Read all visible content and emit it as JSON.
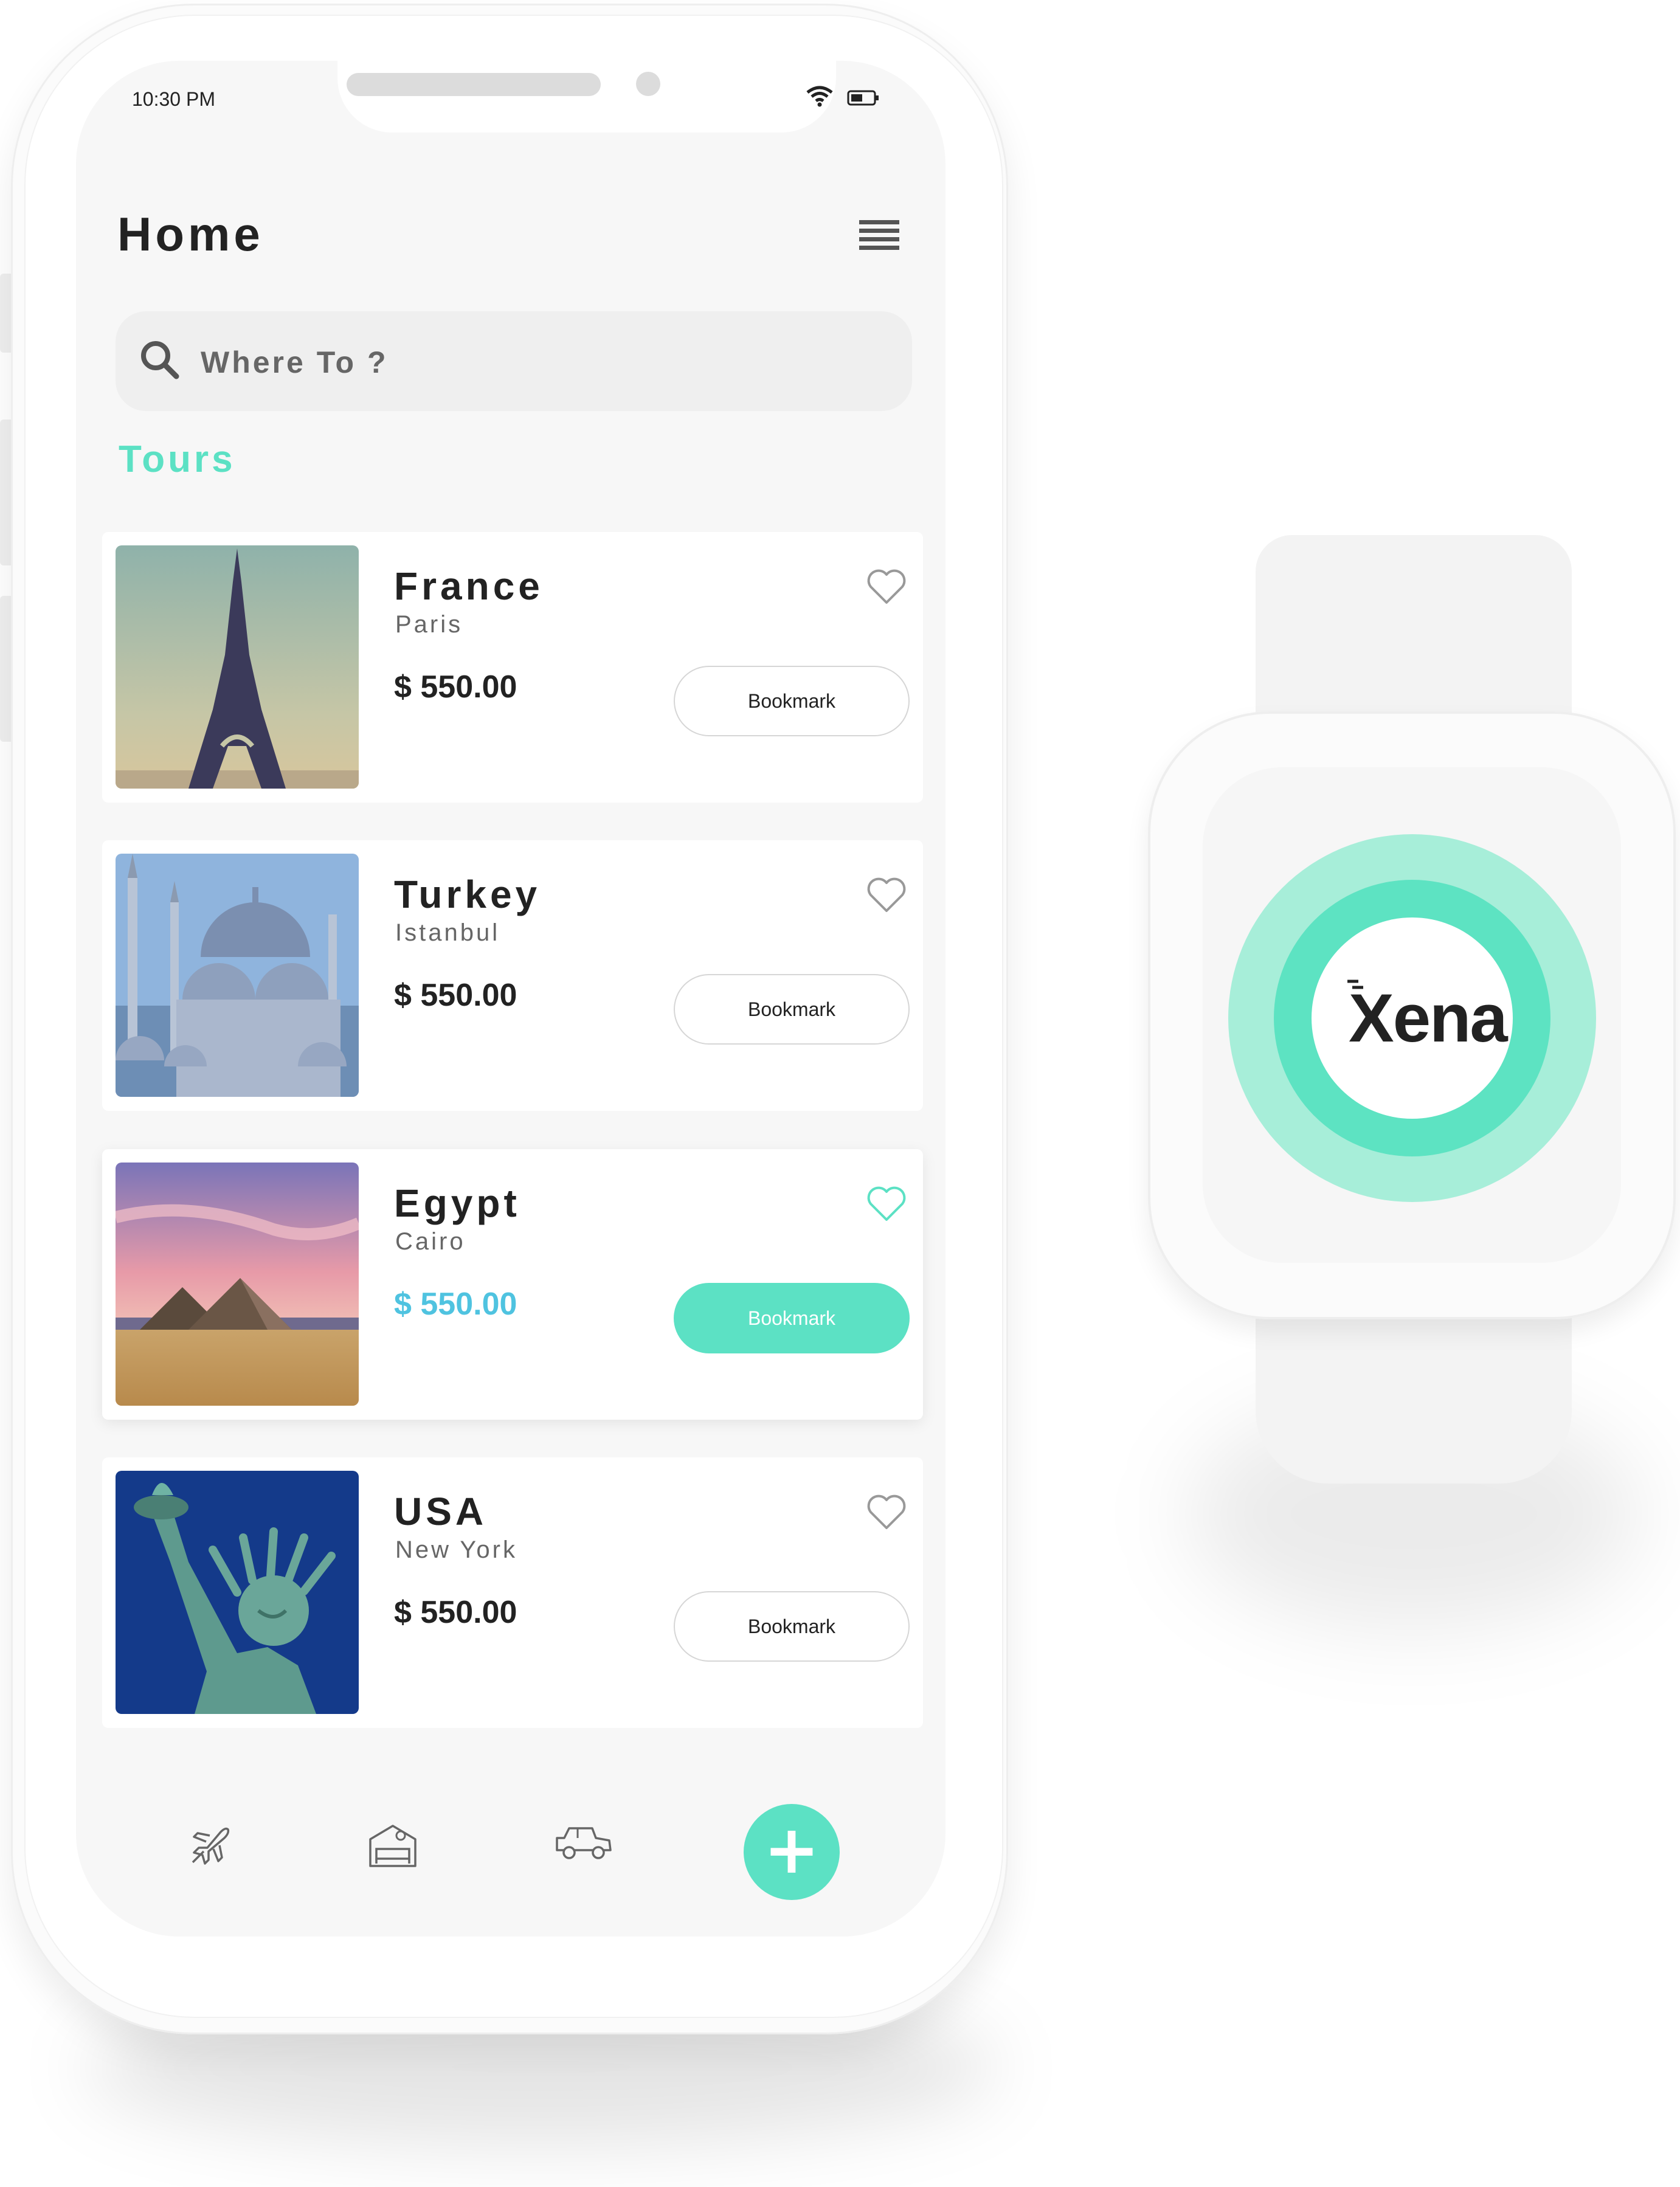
{
  "status_bar": {
    "time": "10:30 PM"
  },
  "header": {
    "title": "Home"
  },
  "search": {
    "placeholder": "Where To ?"
  },
  "section": {
    "title": "Tours"
  },
  "tours": [
    {
      "country": "France",
      "city": "Paris",
      "price": "$ 550.00",
      "button": "Bookmark",
      "favorited": false
    },
    {
      "country": "Turkey",
      "city": "Istanbul",
      "price": "$ 550.00",
      "button": "Bookmark",
      "favorited": false
    },
    {
      "country": "Egypt",
      "city": "Cairo",
      "price": "$ 550.00",
      "button": "Bookmark",
      "favorited": true
    },
    {
      "country": "USA",
      "city": "New York",
      "price": "$ 550.00",
      "button": "Bookmark",
      "favorited": false
    }
  ],
  "tab_bar": {
    "items": [
      "plane-icon",
      "hotel-bed-icon",
      "jeep-icon"
    ],
    "fab": "+"
  },
  "watch": {
    "logo_text": "Xena"
  },
  "colors": {
    "accent": "#5ce1c4",
    "price_highlight": "#4fc3e0",
    "ring_outer": "#a7eed9",
    "ring_mid": "#5de3c2"
  }
}
